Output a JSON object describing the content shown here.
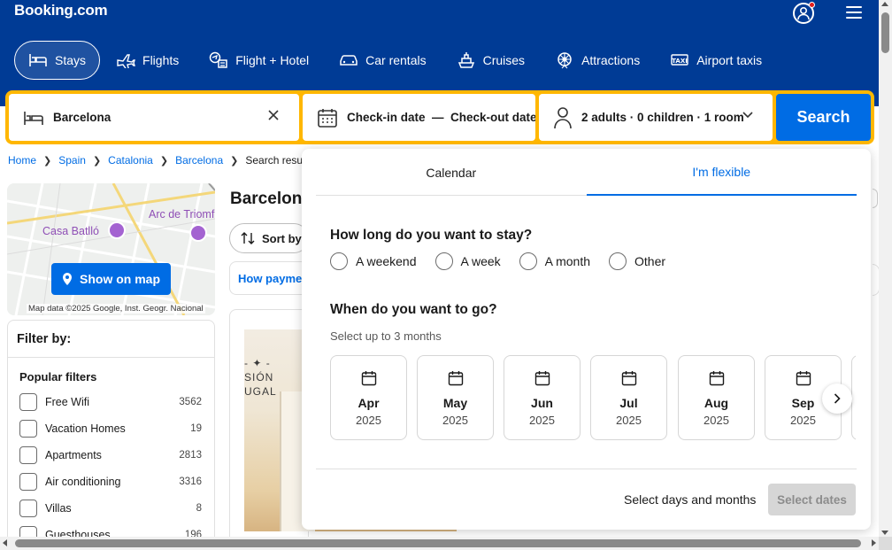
{
  "brand": {
    "logo": "Booking.com",
    "primary": "#003b95",
    "accent": "#006ce4",
    "search_border": "#ffb700"
  },
  "nav": {
    "items": [
      {
        "label": "Stays",
        "icon": "bed-icon"
      },
      {
        "label": "Flights",
        "icon": "plane-icon"
      },
      {
        "label": "Flight + Hotel",
        "icon": "flight-hotel-icon"
      },
      {
        "label": "Car rentals",
        "icon": "car-icon"
      },
      {
        "label": "Cruises",
        "icon": "ship-icon"
      },
      {
        "label": "Attractions",
        "icon": "attractions-icon"
      },
      {
        "label": "Airport taxis",
        "icon": "taxi-icon"
      }
    ]
  },
  "search": {
    "destination": "Barcelona",
    "dates": "Check-in date  —  Check-out date",
    "guests": "2 adults · 0 children · 1 room",
    "button": "Search"
  },
  "breadcrumb": {
    "items": [
      "Home",
      "Spain",
      "Catalonia",
      "Barcelona"
    ],
    "current": "Search results"
  },
  "map": {
    "labels": [
      "Casa Batlló",
      "Arc de Triomf"
    ],
    "button": "Show on map",
    "credit": "Map data ©2025 Google, Inst. Geogr. Nacional"
  },
  "filters": {
    "heading": "Filter by:",
    "group": "Popular filters",
    "items": [
      {
        "label": "Free Wifi",
        "count": "3562"
      },
      {
        "label": "Vacation Homes",
        "count": "19"
      },
      {
        "label": "Apartments",
        "count": "2813"
      },
      {
        "label": "Air conditioning",
        "count": "3316"
      },
      {
        "label": "Villas",
        "count": "8"
      },
      {
        "label": "Guesthouses",
        "count": "196"
      }
    ]
  },
  "results": {
    "title": "Barcelona",
    "sort": "Sort by",
    "payment": "How payment works"
  },
  "popup": {
    "tabs": [
      "Calendar",
      "I'm flexible"
    ],
    "question_stay": "How long do you want to stay?",
    "stay_options": [
      "A weekend",
      "A week",
      "A month",
      "Other"
    ],
    "question_go": "When do you want to go?",
    "hint": "Select up to 3 months",
    "months": [
      {
        "name": "Apr",
        "year": "2025"
      },
      {
        "name": "May",
        "year": "2025"
      },
      {
        "name": "Jun",
        "year": "2025"
      },
      {
        "name": "Jul",
        "year": "2025"
      },
      {
        "name": "Aug",
        "year": "2025"
      },
      {
        "name": "Sep",
        "year": "2025"
      }
    ],
    "footer_text": "Select days and months",
    "select_button": "Select dates"
  }
}
